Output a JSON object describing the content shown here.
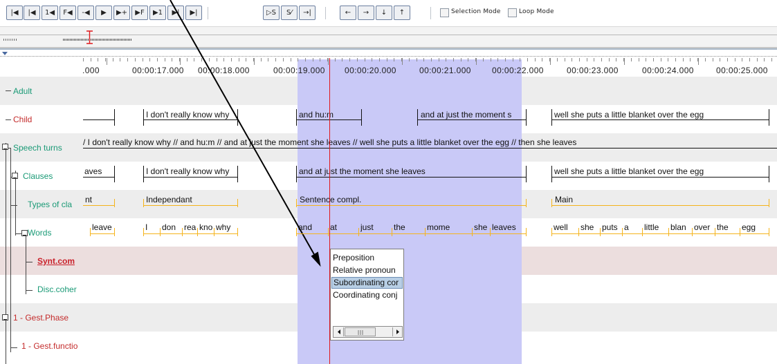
{
  "toolbar": {
    "buttons": [
      {
        "glyph": "|◀",
        "name": "go-to-begin-button"
      },
      {
        "glyph": "|◀",
        "name": "previous-scrollview-button"
      },
      {
        "glyph": "1◀",
        "name": "previous-frame-button"
      },
      {
        "glyph": "F◀",
        "name": "previous-pixel-button"
      },
      {
        "glyph": "-◀",
        "name": "previous-second-button"
      },
      {
        "glyph": "▶",
        "name": "play-pause-button"
      },
      {
        "glyph": "▶+",
        "name": "next-second-button"
      },
      {
        "glyph": "▶F",
        "name": "next-pixel-button"
      },
      {
        "glyph": "▶1",
        "name": "next-frame-button"
      },
      {
        "glyph": "▶|",
        "name": "next-scrollview-button"
      },
      {
        "glyph": "▶|",
        "name": "go-to-end-button"
      },
      {
        "glyph": "▷S",
        "name": "play-selection-button"
      },
      {
        "glyph": "S⁄",
        "name": "clear-selection-button"
      },
      {
        "glyph": "→|",
        "name": "toggle-crosshair-button"
      },
      {
        "glyph": "←",
        "name": "previous-annotation-button"
      },
      {
        "glyph": "→",
        "name": "next-annotation-button"
      },
      {
        "glyph": "↓",
        "name": "annotation-down-button"
      },
      {
        "glyph": "↑",
        "name": "annotation-up-button"
      }
    ],
    "selection_mode_label": "Selection Mode",
    "loop_mode_label": "Loop Mode"
  },
  "ruler": {
    "ticks": [
      ".000",
      "00:00:17.000",
      "00:00:18.000",
      "00:00:19.000",
      "00:00:20.000",
      "00:00:21.000",
      "00:00:22.000",
      "00:00:23.000",
      "00:00:24.000",
      "00:00:25.000"
    ]
  },
  "colors": {
    "selection": "#c9c9f7",
    "crosshair": "#e0181b",
    "child_green": "#1a9a76",
    "child_red": "#c42c2c",
    "active_tier": "#c9202a",
    "grey_row": "#ededed",
    "orange": "#f5b31a"
  },
  "tiers": [
    {
      "label": "Adult",
      "color": "green"
    },
    {
      "label": "Child",
      "color": "red"
    },
    {
      "label": "Speech turns",
      "color": "green"
    },
    {
      "label": "Clauses",
      "color": "green"
    },
    {
      "label": "Types of cla",
      "color": "green"
    },
    {
      "label": "Words",
      "color": "green"
    },
    {
      "label": "Synt.com",
      "color": "active"
    },
    {
      "label": "Disc.coher",
      "color": "green"
    },
    {
      "label": "1 - Gest.Phase",
      "color": "red"
    },
    {
      "label": "1 - Gest.functio",
      "color": "red"
    }
  ],
  "annotations": {
    "child": [
      "I don't really know why",
      "and hu:m",
      "and at just the moment s",
      "well she puts a little blanket over the egg"
    ],
    "speech_turns": "/ I don't really know why // and hu:m // and at just the moment she leaves // well she puts a little blanket over the egg // then she leaves",
    "clauses": [
      "aves",
      "I don't really know why",
      "and at just the moment she leaves",
      "well she puts a little blanket over the egg"
    ],
    "types": [
      "nt",
      "Independant",
      "Sentence compl.",
      "Main"
    ],
    "words": [
      "leave",
      "I",
      "don",
      "real",
      "kno",
      "why",
      "and",
      "at",
      "just",
      "the",
      "mome",
      "she",
      "leaves",
      "well",
      "she",
      "puts",
      "a",
      "little",
      "blan",
      "over",
      "the",
      "egg"
    ]
  },
  "popup": {
    "items": [
      "Preposition",
      "Relative pronoun",
      "Subordinating cor",
      "Coordinating conj"
    ],
    "selected_index": 2
  }
}
